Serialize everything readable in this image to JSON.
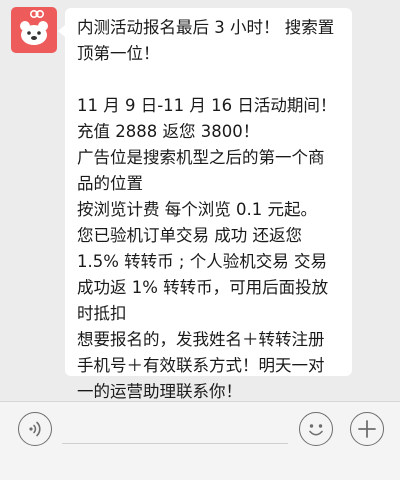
{
  "message": {
    "lines": [
      "内测活动报名最后 3 小时！ 搜索置",
      "顶第一位！",
      "",
      "11 月 9 日-11 月 16 日活动期间！",
      "充值 2888 返您 3800！",
      "广告位是搜索机型之后的第一个商",
      "品的位置",
      "按浏览计费  每个浏览 0.1 元起。",
      "您已验机订单交易 成功 还返您",
      "1.5% 转转币 ;  个人验机交易 交易",
      "成功返 1% 转转币，可用后面投放",
      "时抵扣",
      "想要报名的，发我姓名＋转转注册",
      "手机号＋有效联系方式！明天一对",
      "一的运营助理联系你！"
    ]
  },
  "icons": {
    "avatar": "bear-face-icon",
    "voice": "voice-icon",
    "emoji": "emoji-icon",
    "plus": "plus-icon"
  },
  "colors": {
    "background": "#ececec",
    "bubble": "#ffffff",
    "avatar": "#ee5b5b",
    "text": "#1a1a1a",
    "input_bar": "#f4f4f4"
  }
}
